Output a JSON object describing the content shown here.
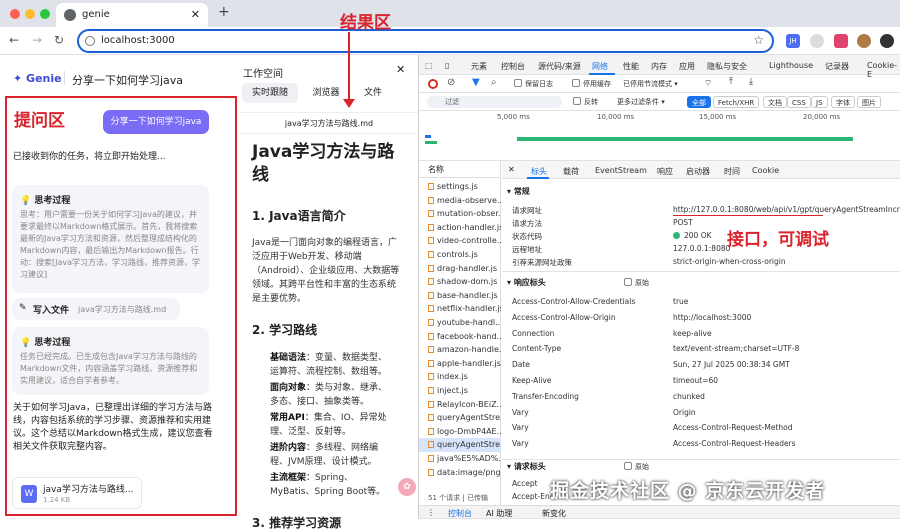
{
  "browser": {
    "tab_title": "genie",
    "url": "localhost:3000",
    "ext_jh": "JH"
  },
  "app": {
    "logo": "Genie",
    "chat_title": "分享一下如何学习java",
    "question_label": "提问区",
    "user_message": "分享一下如何学习java",
    "received": "已接收到你的任务，将立即开始处理...",
    "think1": {
      "title": "思考过程",
      "body": "思考：用户需要一份关于如何学习Java的建议，并要求最终以Markdown格式展示。首先，我将搜索最新的Java学习方法和资源，然后整理成结构化的Markdown内容，最后输出为Markdown报告。行动：搜索[Java学习方法，学习路线，推荐资源，学习建议]"
    },
    "write_file": {
      "title": "写入文件",
      "filename": "java学习方法与路线.md"
    },
    "think2": {
      "title": "思考过程",
      "body": "任务已经完成。已生成包含Java学习方法与路线的Markdown文件，内容涵盖学习路线、资源推荐和实用建议，适合自学者参考。"
    },
    "summary": "关于如何学习Java，已整理出详细的学习方法与路线，内容包括系统的学习步骤、资源推荐和实用建议。这个总结以Markdown格式生成，建议您查看相关文件获取完整内容。",
    "file_card": {
      "name": "java学习方法与路线...",
      "size": "1.24 KB"
    }
  },
  "workspace": {
    "title": "工作空间",
    "tabs": [
      "实时跟随",
      "浏览器",
      "文件"
    ],
    "result_label": "结果区",
    "doc_file": "java学习方法与路线.md",
    "doc_title": "Java学习方法与路线",
    "s1_title": "1. Java语言简介",
    "s1_body": "Java是一门面向对象的编程语言，广泛应用于Web开发、移动端（Android）、企业级应用、大数据等领域。其跨平台性和丰富的生态系统是主要优势。",
    "s2_title": "2. 学习路线",
    "items": [
      {
        "k": "基础语法",
        "v": "：变量、数据类型、运算符、流程控制、数组等。"
      },
      {
        "k": "面向对象",
        "v": "：类与对象、继承、多态、接口、抽象类等。"
      },
      {
        "k": "常用API",
        "v": "：集合、IO、异常处理、泛型、反射等。"
      },
      {
        "k": "进阶内容",
        "v": "：多线程、网络编程、JVM原理、设计模式。"
      },
      {
        "k": "主流框架",
        "v": "：Spring、MyBatis、Spring Boot等。"
      }
    ],
    "s3_title": "3. 推荐学习资源"
  },
  "devtools": {
    "tabs": [
      "元素",
      "控制台",
      "源代码/来源",
      "网络",
      "性能",
      "内存",
      "应用",
      "隐私与安全",
      "Lighthouse",
      "记录器",
      "Cookie-E"
    ],
    "tb_preserve": "保留日志",
    "tb_cache": "停用缓存",
    "tb_throttle": "已停用节流模式",
    "filter": "过滤",
    "invert": "反转",
    "more_filters": "更多过滤条件",
    "type_filters": [
      "全部",
      "Fetch/XHR",
      "文档",
      "CSS",
      "JS",
      "字体",
      "图片"
    ],
    "timeline": [
      "5,000 ms",
      "10,000 ms",
      "15,000 ms",
      "20,000 ms"
    ],
    "name_col": "名称",
    "detail_tabs": [
      "标头",
      "载荷",
      "EventStream",
      "响应",
      "启动器",
      "时间",
      "Cookie"
    ],
    "requests": [
      "settings.js",
      "media-observe...",
      "mutation-obser...",
      "action-handler.js",
      "video-controlle...",
      "controls.js",
      "drag-handler.js",
      "shadow-dom.js",
      "base-handler.js",
      "netflix-handler.js",
      "youtube-handl...",
      "facebook-hand...",
      "amazon-handle...",
      "apple-handler.js",
      "index.js",
      "inject.js",
      "RelayIcon-BEiZ...",
      "queryAgentStre...",
      "logo-DmbP4AE...",
      "queryAgentStre...",
      "java%E5%AD%...",
      "data:image/png..."
    ],
    "req_count": "51 个请求",
    "transferred": "已传输",
    "general_title": "常规",
    "general": [
      {
        "k": "请求网址",
        "v": "http://127.0.0.1:8080/web/api/v1/gpt/queryAgentStreamIncr"
      },
      {
        "k": "请求方法",
        "v": "POST"
      },
      {
        "k": "状态代码",
        "v": "200 OK"
      },
      {
        "k": "远程地址",
        "v": "127.0.0.1:8080"
      },
      {
        "k": "引荐来源网址政策",
        "v": "strict-origin-when-cross-origin"
      }
    ],
    "api_label": "接口，可调试",
    "resp_title": "响应标头",
    "raw": "原始",
    "resp": [
      {
        "k": "Access-Control-Allow-Credentials",
        "v": "true"
      },
      {
        "k": "Access-Control-Allow-Origin",
        "v": "http://localhost:3000"
      },
      {
        "k": "Connection",
        "v": "keep-alive"
      },
      {
        "k": "Content-Type",
        "v": "text/event-stream;charset=UTF-8"
      },
      {
        "k": "Date",
        "v": "Sun, 27 Jul 2025 00:38:34 GMT"
      },
      {
        "k": "Keep-Alive",
        "v": "timeout=60"
      },
      {
        "k": "Transfer-Encoding",
        "v": "chunked"
      },
      {
        "k": "Vary",
        "v": "Origin"
      },
      {
        "k": "Vary",
        "v": "Access-Control-Request-Method"
      },
      {
        "k": "Vary",
        "v": "Access-Control-Request-Headers"
      }
    ],
    "req_title": "请求标头",
    "req_hdrs": [
      {
        "k": "Accept",
        "v": ""
      },
      {
        "k": "Accept-Enc",
        "v": ""
      }
    ],
    "bottom_tabs": [
      "控制台",
      "AI 助理",
      "新变化"
    ],
    "bottom_ai_badge": "▲"
  },
  "watermark": "掘金技术社区 @ 京东云开发者",
  "colors": {
    "accent": "#7b6cf6",
    "annotation_red": "#d9232d",
    "devtools_blue": "#1a73e8"
  }
}
